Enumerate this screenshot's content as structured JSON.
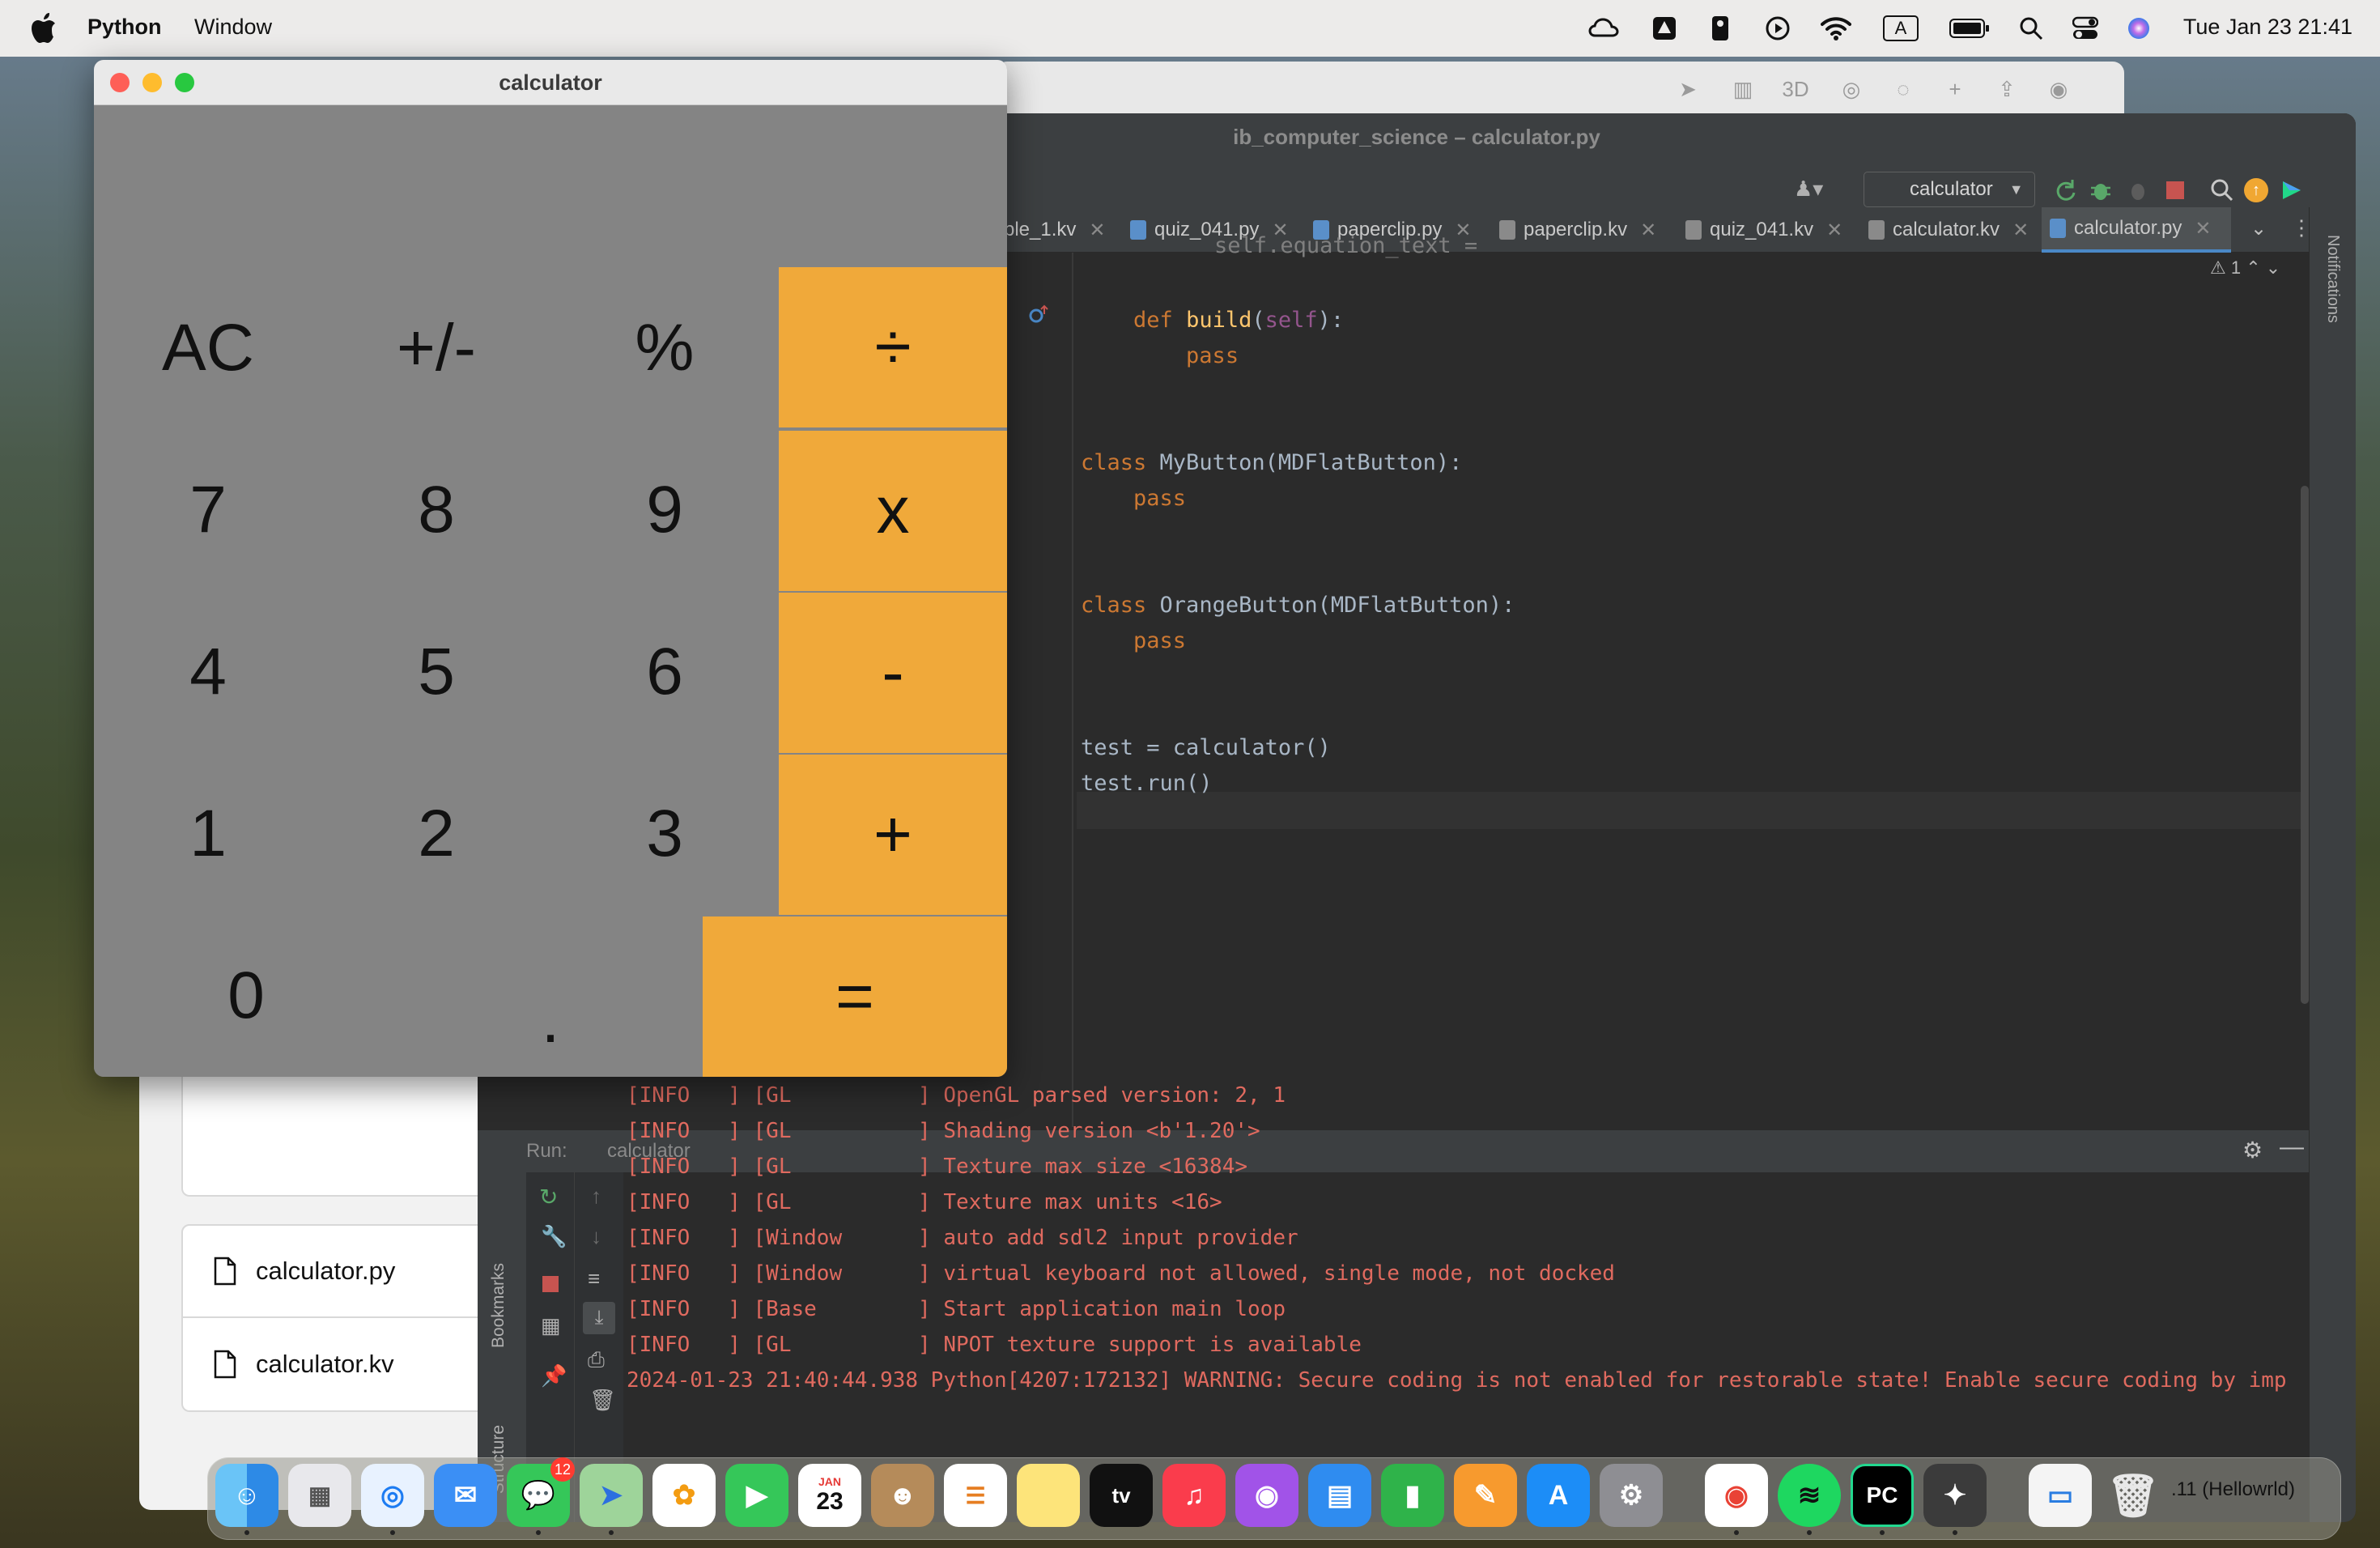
{
  "menubar": {
    "app_name": "Python",
    "menu_window": "Window",
    "clock": "Tue Jan 23  21:41",
    "input_indicator": "A"
  },
  "map_toolbar": {
    "mode_3d": "3D"
  },
  "finder": {
    "files": [
      "calculator.py",
      "calculator.kv"
    ]
  },
  "pycharm": {
    "title": "ib_computer_science – calculator.py",
    "run_config": "calculator",
    "warnings": "1",
    "notifications_label": "Notifications",
    "tabs": [
      {
        "label": "ple_1.kv",
        "kind": "kv"
      },
      {
        "label": "quiz_041.py",
        "kind": "py"
      },
      {
        "label": "paperclip.py",
        "kind": "py"
      },
      {
        "label": "paperclip.kv",
        "kind": "kv"
      },
      {
        "label": "quiz_041.kv",
        "kind": "kv"
      },
      {
        "label": "calculator.kv",
        "kind": "kv"
      },
      {
        "label": "calculator.py",
        "kind": "py",
        "active": true
      }
    ],
    "code": {
      "l0": "        self.equation_text =",
      "def_kw": "def ",
      "def_name": "build",
      "def_open": "(",
      "def_self": "self",
      "def_close": "):",
      "pass": "pass",
      "class_kw": "class ",
      "mybutton": "MyButton(MDFlatButton):",
      "orangebutton": "OrangeButton(MDFlatButton):",
      "test1": "test = calculator()",
      "test2": "test.run()"
    },
    "run_panel": {
      "tab_run": "Run:",
      "tab_config": "calculator",
      "bookmarks_label": "Bookmarks",
      "structure_label": "Structure",
      "log": [
        "[INFO   ] [GL          ] OpenGL parsed version: 2, 1",
        "[INFO   ] [GL          ] Shading version <b'1.20'>",
        "[INFO   ] [GL          ] Texture max size <16384>",
        "[INFO   ] [GL          ] Texture max units <16>",
        "[INFO   ] [Window      ] auto add sdl2 input provider",
        "[INFO   ] [Window      ] virtual keyboard not allowed, single mode, not docked",
        "[INFO   ] [Base        ] Start application main loop",
        "[INFO   ] [GL          ] NPOT texture support is available",
        "2024-01-23 21:40:44.938 Python[4207:172132] WARNING: Secure coding is not enabled for restorable state! Enable secure coding by imp"
      ]
    },
    "status_bar_text": ".11 (Hellowrld)"
  },
  "calculator": {
    "title": "calculator",
    "buttons": {
      "ac": "AC",
      "sign": "+/-",
      "percent": "%",
      "divide": "÷",
      "seven": "7",
      "eight": "8",
      "nine": "9",
      "multiply": "x",
      "four": "4",
      "five": "5",
      "six": "6",
      "minus": "-",
      "one": "1",
      "two": "2",
      "three": "3",
      "plus": "+",
      "zero": "0",
      "dot": ".",
      "equals": "="
    },
    "colors": {
      "orange": "#f0a93a",
      "grey": "#848484"
    }
  },
  "dock": {
    "messages_badge": "12",
    "calendar_month": "JAN",
    "calendar_day": "23",
    "tv_label": "tv",
    "pycharm_label": "PC",
    "apps": [
      "finder-icon",
      "launchpad-icon",
      "safari-icon",
      "mail-icon",
      "messages-icon",
      "maps-icon",
      "photos-icon",
      "facetime-icon",
      "calendar-icon",
      "contacts-icon",
      "reminders-icon",
      "notes-icon",
      "appletv-icon",
      "music-icon",
      "podcasts-icon",
      "keynote-icon",
      "numbers-icon",
      "pages-icon",
      "appstore-icon",
      "system-settings-icon",
      "chrome-icon",
      "spotify-icon",
      "pycharm-icon",
      "kivy-icon",
      "preview-icon",
      "trash-icon"
    ]
  }
}
